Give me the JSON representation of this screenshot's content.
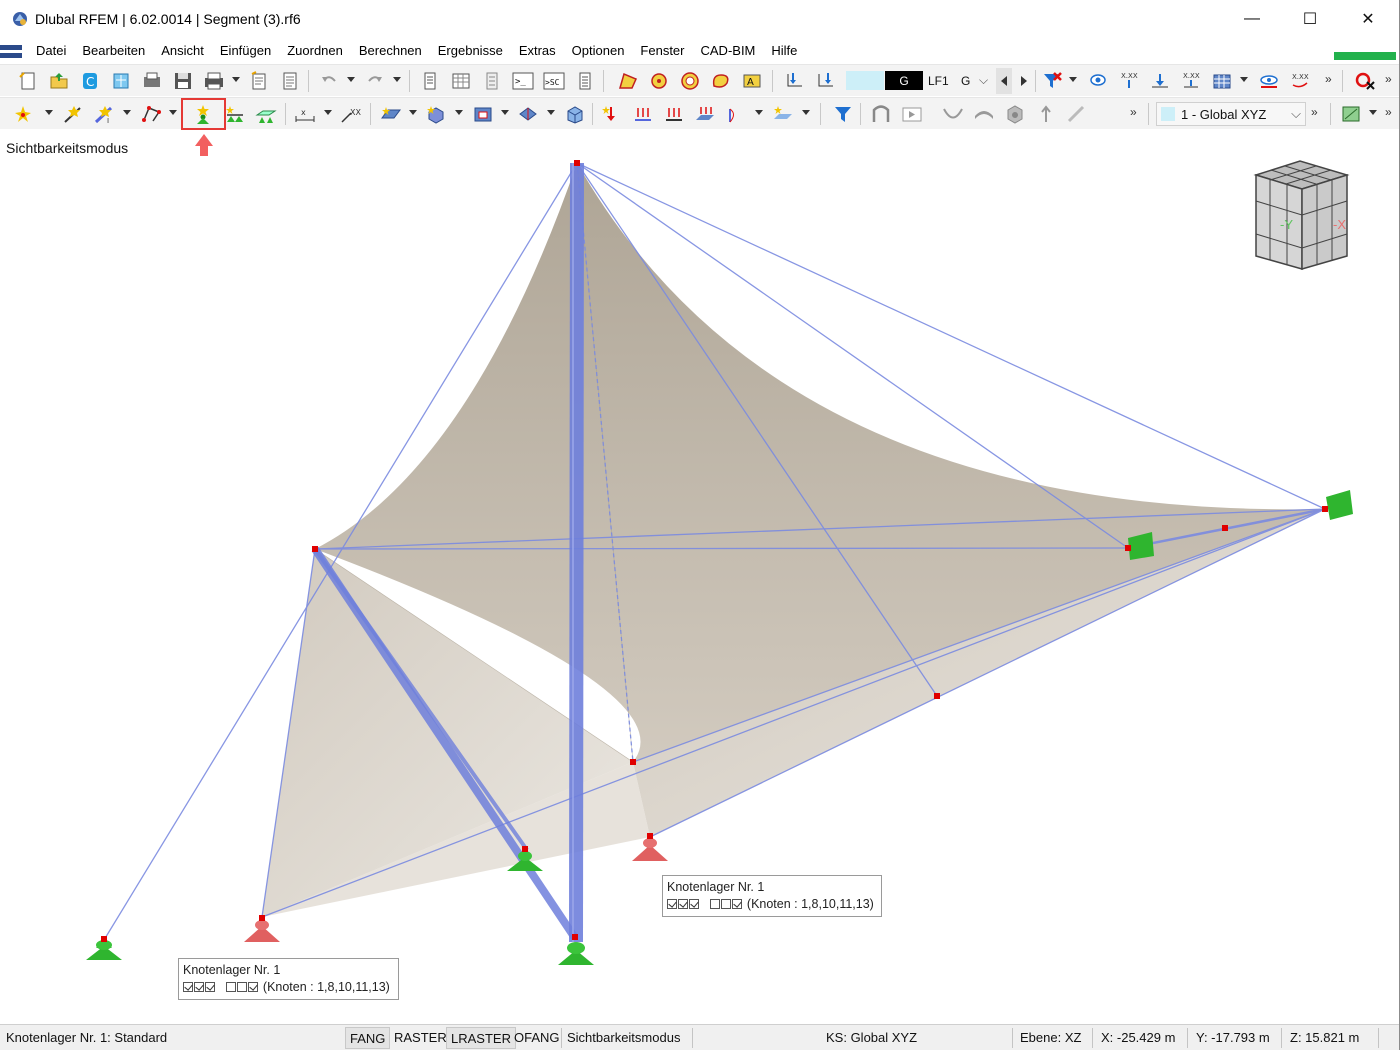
{
  "window": {
    "title": "Dlubal RFEM | 6.02.0014 | Segment (3).rf6",
    "minimize": "—",
    "maximize": "☐",
    "close": "✕"
  },
  "menu": {
    "items": [
      "Datei",
      "Bearbeiten",
      "Ansicht",
      "Einfügen",
      "Zuordnen",
      "Berechnen",
      "Ergebnisse",
      "Extras",
      "Optionen",
      "Fenster",
      "CAD-BIM",
      "Hilfe"
    ]
  },
  "toolbar1": {
    "load_case_type": "G",
    "load_case": "LF1",
    "load_case_group": "G",
    "more": "»"
  },
  "toolbar2": {
    "coordinate_system": "1 - Global XYZ",
    "more": "»"
  },
  "viewport": {
    "mode_label": "Sichtbarkeitsmodus",
    "nav_cube_y": "-Y",
    "nav_cube_x": "-X"
  },
  "tooltips": [
    {
      "title": "Knotenlager Nr. 1",
      "nodes": "(Knoten : 1,8,10,11,13)"
    },
    {
      "title": "Knotenlager Nr. 1",
      "nodes": "(Knoten : 1,8,10,11,13)"
    }
  ],
  "status": {
    "left": "Knotenlager Nr. 1: Standard",
    "fang": "FANG",
    "raster": "RASTER",
    "lraster": "LRASTER",
    "ofang": "OFANG",
    "mode": "Sichtbarkeitsmodus",
    "ks": "KS: Global XYZ",
    "plane": "Ebene: XZ",
    "x": "X: -25.429 m",
    "y": "Y: -17.793 m",
    "z": "Z: 15.821 m"
  },
  "colors": {
    "membrane": "#b6aa98",
    "member": "#7b8be0",
    "support_green": "#2fb52f",
    "support_red": "#e06060",
    "node": "#e00000",
    "highlight": "#e53935"
  }
}
